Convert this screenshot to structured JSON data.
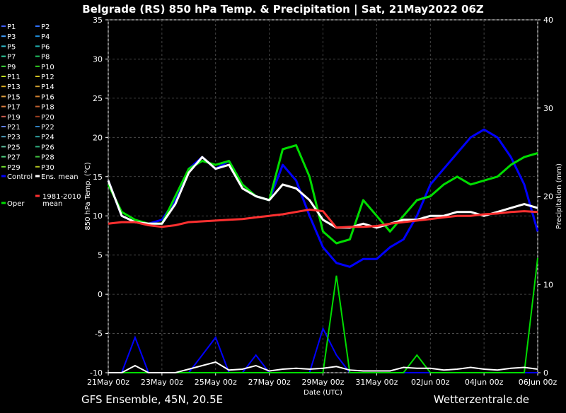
{
  "chart_data": {
    "type": "line",
    "title": "Belgrade  (RS)  850 hPa Temp. & Precipitation | Sat, 21May2022 06Z",
    "ylabel": "850 hPa Temp. (°C)",
    "y2label": "Precipitation (mm)",
    "xlabel": "Date (UTC)",
    "ylim": [
      -10,
      35
    ],
    "y2lim": [
      0,
      40
    ],
    "yticks": [
      -10,
      -5,
      0,
      5,
      10,
      15,
      20,
      25,
      30,
      35
    ],
    "y2ticks": [
      0,
      10,
      20,
      30,
      40
    ],
    "xlim": [
      0,
      16
    ],
    "xticks": [
      {
        "x": 0,
        "label": "21May 00z"
      },
      {
        "x": 2,
        "label": "23May 00z"
      },
      {
        "x": 4,
        "label": "25May 00z"
      },
      {
        "x": 6,
        "label": "27May 00z"
      },
      {
        "x": 8,
        "label": "29May 00z"
      },
      {
        "x": 10,
        "label": "31May 00z"
      },
      {
        "x": 12,
        "label": "02Jun 00z"
      },
      {
        "x": 14,
        "label": "04Jun 00z"
      },
      {
        "x": 16,
        "label": "06Jun 00z"
      }
    ],
    "grid": true,
    "legend_position": "left",
    "legend": [
      {
        "name": "P1",
        "color": "#4060ff"
      },
      {
        "name": "P2",
        "color": "#3070ff"
      },
      {
        "name": "P3",
        "color": "#40a0ff"
      },
      {
        "name": "P4",
        "color": "#2090e0"
      },
      {
        "name": "P5",
        "color": "#30c0d0"
      },
      {
        "name": "P6",
        "color": "#20b0b0"
      },
      {
        "name": "P7",
        "color": "#30d0a0"
      },
      {
        "name": "P8",
        "color": "#20c060"
      },
      {
        "name": "P9",
        "color": "#40e040"
      },
      {
        "name": "P10",
        "color": "#30d020"
      },
      {
        "name": "P11",
        "color": "#c0e020"
      },
      {
        "name": "P12",
        "color": "#d0c020"
      },
      {
        "name": "P13",
        "color": "#e0b020"
      },
      {
        "name": "P14",
        "color": "#d0a030"
      },
      {
        "name": "P15",
        "color": "#e0a040"
      },
      {
        "name": "P16",
        "color": "#d08030"
      },
      {
        "name": "P17",
        "color": "#e08040"
      },
      {
        "name": "P18",
        "color": "#c06030"
      },
      {
        "name": "P19",
        "color": "#d06050"
      },
      {
        "name": "P20",
        "color": "#a04020"
      },
      {
        "name": "P21",
        "color": "#6080ff"
      },
      {
        "name": "P22",
        "color": "#3080c0"
      },
      {
        "name": "P23",
        "color": "#50a0c0"
      },
      {
        "name": "P24",
        "color": "#30a0a0"
      },
      {
        "name": "P25",
        "color": "#60c0a0"
      },
      {
        "name": "P26",
        "color": "#30b080"
      },
      {
        "name": "P27",
        "color": "#50d080"
      },
      {
        "name": "P28",
        "color": "#40c040"
      },
      {
        "name": "P29",
        "color": "#70e030"
      },
      {
        "name": "P30",
        "color": "#b0c020"
      },
      {
        "name": "Control",
        "color": "#0000ff"
      },
      {
        "name": "Ens. mean",
        "color": "#ffffff"
      },
      {
        "name": "1981-2010 mean",
        "color": "#ff3030"
      },
      {
        "name": "Oper",
        "color": "#00dd00"
      }
    ],
    "x": [
      0,
      0.5,
      1,
      1.5,
      2,
      2.5,
      3,
      3.5,
      4,
      4.5,
      5,
      5.5,
      6,
      6.5,
      7,
      7.5,
      8,
      8.5,
      9,
      9.5,
      10,
      10.5,
      11,
      11.5,
      12,
      12.5,
      13,
      13.5,
      14,
      14.5,
      15,
      15.5,
      16
    ],
    "series": [
      {
        "name": "Control",
        "color": "#0000ff",
        "values": [
          14.5,
          10,
          9.2,
          9,
          9.5,
          12,
          16,
          17.5,
          16,
          17,
          14,
          12.5,
          12,
          16.5,
          14.5,
          10,
          6,
          4,
          3.5,
          4.5,
          4.5,
          6,
          7,
          10,
          14,
          16,
          18,
          20,
          21,
          20,
          17.5,
          14,
          8
        ]
      },
      {
        "name": "Oper",
        "color": "#00dd00",
        "values": [
          14,
          10.5,
          9.5,
          9,
          9,
          12.5,
          16,
          17,
          16.5,
          17,
          14,
          12.5,
          12,
          18.5,
          19,
          15,
          8,
          6.5,
          7,
          12,
          10,
          8,
          10,
          12,
          12.5,
          14,
          15,
          14,
          14.5,
          15,
          16.5,
          17.5,
          18
        ]
      },
      {
        "name": "Ens. mean",
        "color": "#ffffff",
        "values": [
          14.5,
          10,
          9.2,
          9,
          9,
          11.5,
          15.5,
          17.5,
          16,
          16.5,
          13.5,
          12.5,
          12,
          14,
          13.5,
          12,
          9.5,
          8.5,
          8.5,
          9,
          8.5,
          9,
          9.5,
          9.5,
          10,
          10,
          10.5,
          10.5,
          10,
          10.5,
          11,
          11.5,
          11
        ]
      },
      {
        "name": "1981-2010 mean",
        "color": "#ff3030",
        "values": [
          9,
          9.2,
          9.2,
          8.8,
          8.6,
          8.8,
          9.2,
          9.3,
          9.4,
          9.5,
          9.6,
          9.8,
          10,
          10.2,
          10.5,
          10.8,
          10.6,
          8.5,
          8.6,
          8.6,
          8.7,
          9,
          9.2,
          9.4,
          9.6,
          9.8,
          10,
          10,
          10.2,
          10.3,
          10.5,
          10.6,
          10.5
        ]
      }
    ],
    "precipitation": [
      {
        "name": "Control",
        "color": "#0000ff",
        "values": [
          0,
          0,
          4,
          0,
          0,
          0,
          0,
          2,
          4,
          0,
          0,
          2,
          0,
          0,
          0,
          0,
          5,
          2,
          0,
          0,
          0,
          0,
          0,
          0,
          0,
          0,
          0,
          0,
          0,
          0,
          0,
          0,
          0
        ]
      },
      {
        "name": "Oper",
        "color": "#00dd00",
        "values": [
          0,
          0,
          0,
          0,
          0,
          0,
          0,
          0,
          0,
          0,
          0,
          0,
          0,
          0,
          0,
          0,
          0,
          11,
          0,
          0,
          0,
          0,
          0,
          2,
          0,
          0,
          0,
          0,
          0,
          0,
          0,
          0,
          13
        ]
      },
      {
        "name": "Ens. mean",
        "color": "#ffffff",
        "values": [
          0,
          0,
          0.8,
          0,
          0,
          0,
          0.4,
          0.8,
          1.2,
          0.3,
          0.4,
          0.8,
          0.2,
          0.4,
          0.5,
          0.4,
          0.5,
          0.7,
          0.3,
          0.2,
          0.2,
          0.2,
          0.6,
          0.5,
          0.5,
          0.3,
          0.4,
          0.6,
          0.4,
          0.3,
          0.5,
          0.6,
          0.4
        ]
      }
    ]
  },
  "footer": {
    "source_label": "GFS Ensemble, 45N, 20.5E",
    "site_label": "Wetterzentrale.de"
  }
}
